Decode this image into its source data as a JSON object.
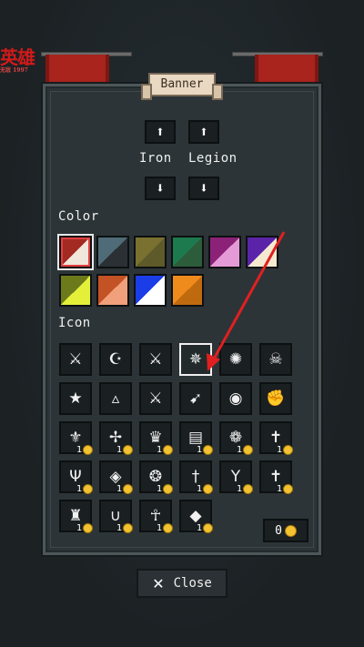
{
  "watermark": {
    "main": "英雄",
    "sub": "无敌 1997"
  },
  "header": {
    "title": "Banner"
  },
  "banner_settings": {
    "first_word": "Iron",
    "second_word": "Legion",
    "up_icon": "arrow-up-icon",
    "down_icon": "arrow-down-icon"
  },
  "color_section": {
    "label": "Color",
    "swatches": [
      {
        "a": "#a32a22",
        "b": "#f1e6dc",
        "selected": true
      },
      {
        "a": "#4f6b78",
        "b": "#2a3033",
        "selected": false
      },
      {
        "a": "#7a7030",
        "b": "#5f5a2a",
        "selected": false
      },
      {
        "a": "#1d7a4e",
        "b": "#2d5c3a",
        "selected": false
      },
      {
        "a": "#8c2278",
        "b": "#e59ad8",
        "selected": false
      },
      {
        "a": "#5b24a8",
        "b": "#f5ead0",
        "selected": false
      },
      {
        "a": "#6c7a1c",
        "b": "#e4ef3a",
        "selected": false
      },
      {
        "a": "#c35225",
        "b": "#f0a07a",
        "selected": false
      },
      {
        "a": "#1a3de8",
        "b": "#ffffff",
        "selected": false
      },
      {
        "a": "#ef8a1c",
        "b": "#c06a10",
        "selected": false
      }
    ]
  },
  "icon_section": {
    "label": "Icon",
    "icons": [
      {
        "name": "crossed-swords-wing-icon",
        "glyph": "⚔",
        "cost": ""
      },
      {
        "name": "crescent-star-icon",
        "glyph": "☪",
        "cost": ""
      },
      {
        "name": "crossed-swords-icon",
        "glyph": "⚔",
        "cost": ""
      },
      {
        "name": "sunburst-skull-icon",
        "glyph": "✵",
        "cost": "",
        "selected": true
      },
      {
        "name": "sun-icon",
        "glyph": "✺",
        "cost": ""
      },
      {
        "name": "skull-crossbones-icon",
        "glyph": "☠",
        "cost": ""
      },
      {
        "name": "star-icon",
        "glyph": "★",
        "cost": ""
      },
      {
        "name": "triangle-emblem-icon",
        "glyph": "▵",
        "cost": ""
      },
      {
        "name": "sword-icon",
        "glyph": "⚔",
        "cost": ""
      },
      {
        "name": "bow-icon",
        "glyph": "➹",
        "cost": ""
      },
      {
        "name": "discord-icon",
        "glyph": "◉",
        "cost": ""
      },
      {
        "name": "fist-icon",
        "glyph": "✊",
        "cost": ""
      },
      {
        "name": "fleur-de-lis-icon",
        "glyph": "⚜",
        "cost": "1"
      },
      {
        "name": "sword-star-icon",
        "glyph": "✢",
        "cost": "1"
      },
      {
        "name": "crown-icon",
        "glyph": "♛",
        "cost": "1"
      },
      {
        "name": "book-icon",
        "glyph": "▤",
        "cost": "1"
      },
      {
        "name": "flower-icon",
        "glyph": "❁",
        "cost": "1"
      },
      {
        "name": "cross-icon",
        "glyph": "✝",
        "cost": "1"
      },
      {
        "name": "trident-icon",
        "glyph": "Ψ",
        "cost": "1"
      },
      {
        "name": "diamond-icon",
        "glyph": "◈",
        "cost": "1"
      },
      {
        "name": "wheel-icon",
        "glyph": "❂",
        "cost": "1"
      },
      {
        "name": "dagger-icon",
        "glyph": "†",
        "cost": "1"
      },
      {
        "name": "branch-icon",
        "glyph": "Y",
        "cost": "1"
      },
      {
        "name": "figure-icon",
        "glyph": "✝",
        "cost": "1"
      },
      {
        "name": "castle-icon",
        "glyph": "♜",
        "cost": "1"
      },
      {
        "name": "horseshoe-icon",
        "glyph": "∪",
        "cost": "1"
      },
      {
        "name": "tiki-icon",
        "glyph": "☥",
        "cost": "1"
      },
      {
        "name": "fish-icon",
        "glyph": "◆",
        "cost": "1"
      }
    ]
  },
  "currency": {
    "amount": "0",
    "icon": "coin-icon"
  },
  "footer": {
    "close_label": "Close",
    "close_icon": "close-icon"
  },
  "accent_colors": {
    "banner_red": "#a8241d",
    "coin_gold": "#f2c230",
    "pointer_red": "#e02020"
  }
}
